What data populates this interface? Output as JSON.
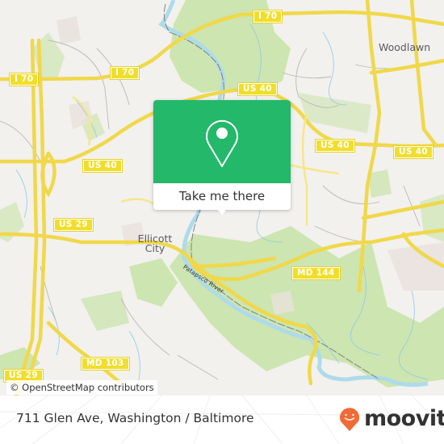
{
  "map": {
    "road_shields": [
      {
        "id": "i70-west",
        "label": "I 70"
      },
      {
        "id": "i70-north",
        "label": "I 70"
      },
      {
        "id": "i70-top",
        "label": "I 70"
      },
      {
        "id": "us40-center",
        "label": "US 40"
      },
      {
        "id": "us40-east1",
        "label": "US 40"
      },
      {
        "id": "us40-east2",
        "label": "US 40"
      },
      {
        "id": "us40-west",
        "label": "US 40"
      },
      {
        "id": "us29-mid",
        "label": "US 29"
      },
      {
        "id": "us29-bottom",
        "label": "US 29"
      },
      {
        "id": "md144",
        "label": "MD 144"
      },
      {
        "id": "md103",
        "label": "MD 103"
      }
    ],
    "places": [
      {
        "id": "woodlawn",
        "label": "Woodlawn"
      },
      {
        "id": "ellicott-city",
        "label": "Ellicott City"
      }
    ],
    "river_label": "Patapsco River",
    "colors": {
      "land": "#f2f1ee",
      "park": "#cde5b0",
      "road": "#f7e26b",
      "water": "#aedbea",
      "stream": "#8ecae6"
    }
  },
  "popup": {
    "icon": "location-pin-icon",
    "action_label": "Take me there",
    "color": "#23b86a"
  },
  "attribution": "© OpenStreetMap contributors",
  "footer": {
    "address": "711 Glen Ave, Washington / Baltimore",
    "brand": "moovit",
    "brand_color": "#f26a36"
  }
}
